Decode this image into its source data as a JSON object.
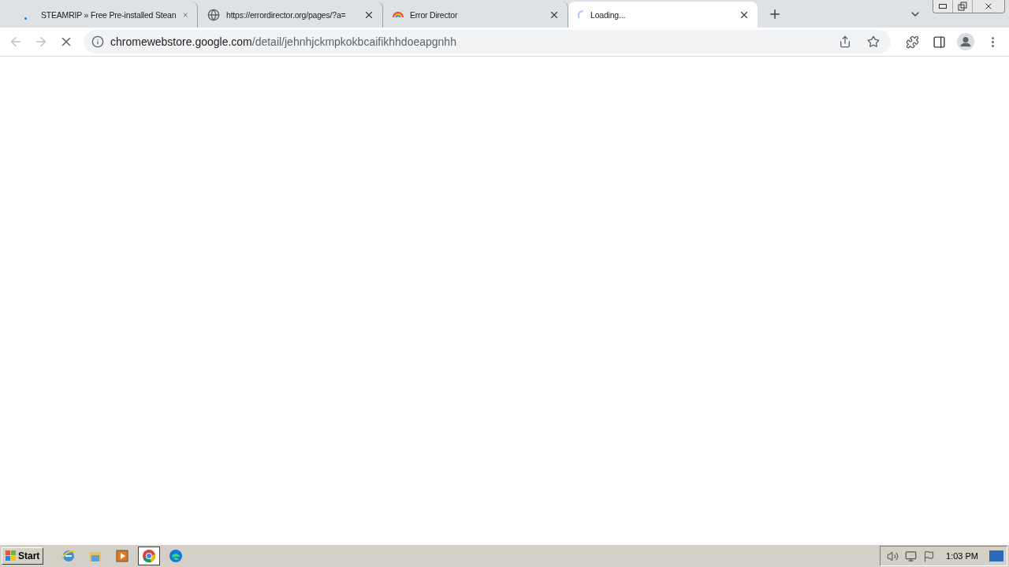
{
  "tabs": [
    {
      "kind": "dot",
      "title": "STEAMRIP » Free Pre-installed Stean",
      "selected": false
    },
    {
      "kind": "globe",
      "title": "https://errordirector.org/pages/?a=",
      "selected": false
    },
    {
      "kind": "rainbow",
      "title": "Error Director",
      "selected": false
    },
    {
      "kind": "spinner",
      "title": "Loading...",
      "selected": true
    }
  ],
  "address_bar": {
    "host": "chromewebstore.google.com",
    "path": "/detail/jehnhjckmpkokbcaifikhhdoeapgnhh"
  },
  "taskbar": {
    "start": "Start",
    "apps": [
      {
        "kind": "ie",
        "selected": false
      },
      {
        "kind": "folder",
        "selected": false
      },
      {
        "kind": "media",
        "selected": false
      },
      {
        "kind": "chrome",
        "selected": true
      },
      {
        "kind": "edge",
        "selected": false
      }
    ],
    "clock": "1:03 PM"
  }
}
